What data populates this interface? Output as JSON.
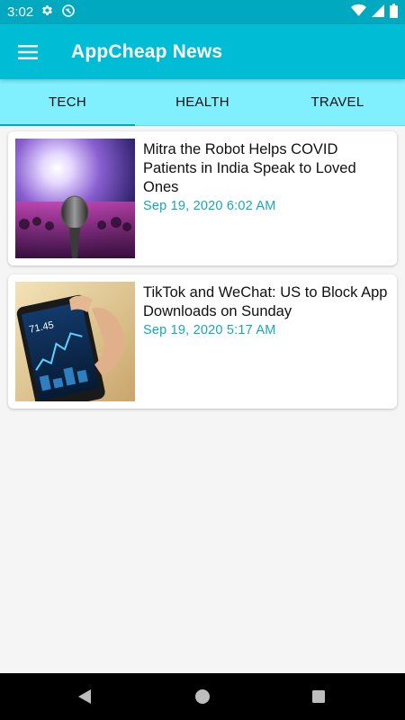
{
  "status_bar": {
    "time": "3:02",
    "icons": [
      "gear-icon",
      "sync-icon",
      "wifi-icon",
      "signal-icon",
      "battery-icon"
    ]
  },
  "app_bar": {
    "title": "AppCheap News",
    "menu_icon": "hamburger-menu-icon",
    "color": "#00bcd4"
  },
  "tabs": [
    {
      "label": "TECH",
      "active": true
    },
    {
      "label": "HEALTH",
      "active": false
    },
    {
      "label": "TRAVEL",
      "active": false
    }
  ],
  "articles": [
    {
      "headline": "Mitra the Robot Helps COVID Patients in India Speak to Loved Ones",
      "date": "Sep 19, 2020 6:02 AM",
      "image": "microphone-concert-image"
    },
    {
      "headline": "TikTok and WeChat: US to Block App Downloads on Sunday",
      "date": "Sep 19, 2020 5:17 AM",
      "image": "phone-stock-chart-image",
      "phone_readout": "71.45"
    }
  ],
  "nav_bar": {
    "icons": [
      "back-icon",
      "home-icon",
      "recents-icon"
    ]
  },
  "colors": {
    "accent": "#00bcd4",
    "tab_background": "#80f0ff",
    "date_text": "#14a8bd"
  }
}
